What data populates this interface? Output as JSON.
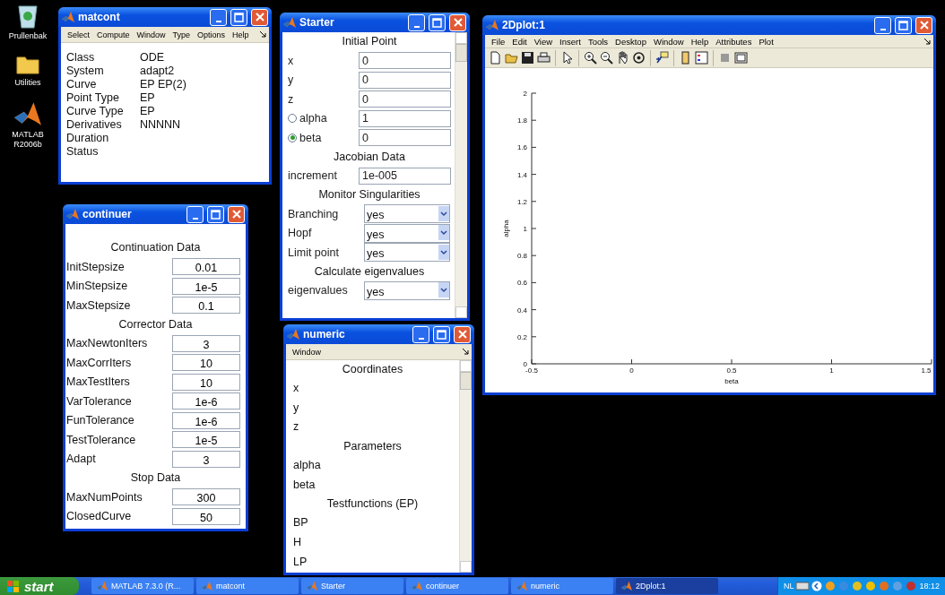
{
  "desktop_icons": [
    {
      "kind": "recycle",
      "label": "Prullenbak"
    },
    {
      "kind": "folder",
      "label": "Utilities"
    },
    {
      "kind": "matlab",
      "label": "MATLAB R2006b"
    }
  ],
  "matcont": {
    "title": "matcont",
    "menu": [
      "Select",
      "Compute",
      "Window",
      "Type",
      "Options",
      "Help"
    ],
    "rows": [
      {
        "label": "Class",
        "value": "ODE"
      },
      {
        "label": "System",
        "value": "adapt2"
      },
      {
        "label": "Curve",
        "value": "EP  EP(2)"
      },
      {
        "label": "Point Type",
        "value": "EP"
      },
      {
        "label": "Curve Type",
        "value": "EP"
      },
      {
        "label": "Derivatives",
        "value": "NNNNN"
      },
      {
        "label": "Duration"
      },
      {
        "label": "Status"
      }
    ]
  },
  "continuer": {
    "title": "continuer",
    "sections": [
      {
        "heading": "Continuation Data",
        "fields": [
          {
            "label": "InitStepsize",
            "value": "0.01"
          },
          {
            "label": "MinStepsize",
            "value": "1e-5"
          },
          {
            "label": "MaxStepsize",
            "value": "0.1"
          }
        ]
      },
      {
        "heading": "Corrector Data",
        "fields": [
          {
            "label": "MaxNewtonIters",
            "value": "3"
          },
          {
            "label": "MaxCorrIters",
            "value": "10"
          },
          {
            "label": "MaxTestIters",
            "value": "10"
          },
          {
            "label": "VarTolerance",
            "value": "1e-6"
          },
          {
            "label": "FunTolerance",
            "value": "1e-6"
          },
          {
            "label": "TestTolerance",
            "value": "1e-5"
          },
          {
            "label": "Adapt",
            "value": "3"
          }
        ]
      },
      {
        "heading": "Stop Data",
        "fields": [
          {
            "label": "MaxNumPoints",
            "value": "300"
          },
          {
            "label": "ClosedCurve",
            "value": "50"
          }
        ]
      }
    ]
  },
  "starter": {
    "title": "Starter",
    "sections": [
      {
        "heading": "Initial Point",
        "rows": [
          {
            "kind": "input",
            "label": "x",
            "value": "0"
          },
          {
            "kind": "input",
            "label": "y",
            "value": "0"
          },
          {
            "kind": "input",
            "label": "z",
            "value": "0"
          },
          {
            "kind": "radio",
            "label": "alpha",
            "value": "1",
            "selected": false
          },
          {
            "kind": "radio",
            "label": "beta",
            "value": "0",
            "selected": true
          }
        ]
      },
      {
        "heading": "Jacobian Data",
        "rows": [
          {
            "kind": "input",
            "label": "increment",
            "value": "1e-005"
          }
        ]
      },
      {
        "heading": "Monitor Singularities",
        "rows": [
          {
            "kind": "select",
            "label": "Branching",
            "value": "yes"
          },
          {
            "kind": "select",
            "label": "Hopf",
            "value": "yes"
          },
          {
            "kind": "select",
            "label": "Limit point",
            "value": "yes"
          }
        ]
      },
      {
        "heading": "Calculate eigenvalues",
        "rows": [
          {
            "kind": "select",
            "label": "eigenvalues",
            "value": "yes"
          }
        ]
      }
    ]
  },
  "numeric": {
    "title": "numeric",
    "menu": [
      "Window"
    ],
    "sections": [
      {
        "heading": "Coordinates",
        "items": [
          "x",
          "y",
          "z"
        ]
      },
      {
        "heading": "Parameters",
        "items": [
          "alpha",
          "beta"
        ]
      },
      {
        "heading": "Testfunctions (EP)",
        "items": [
          "BP",
          "H",
          "LP"
        ]
      }
    ]
  },
  "plot": {
    "title": "2Dplot:1",
    "menu": [
      "File",
      "Edit",
      "View",
      "Insert",
      "Tools",
      "Desktop",
      "Window",
      "Help",
      "Attributes",
      "Plot"
    ],
    "chart_data": {
      "type": "line",
      "xlabel": "beta",
      "ylabel": "alpha",
      "xlim": [
        -0.5,
        1.5
      ],
      "ylim": [
        0,
        2
      ],
      "xticks": [
        -0.5,
        0,
        0.5,
        1,
        1.5
      ],
      "yticks": [
        0,
        0.2,
        0.4,
        0.6,
        0.8,
        1,
        1.2,
        1.4,
        1.6,
        1.8,
        2
      ]
    }
  },
  "taskbar": {
    "start": "start",
    "tasks": [
      {
        "label": "MATLAB 7.3.0 (R...",
        "selected": false
      },
      {
        "label": "matcont",
        "selected": false
      },
      {
        "label": "Starter",
        "selected": false
      },
      {
        "label": "continuer",
        "selected": false
      },
      {
        "label": "numeric",
        "selected": false
      },
      {
        "label": "2Dplot:1",
        "selected": true
      }
    ],
    "language": "NL",
    "clock": "18:12"
  }
}
